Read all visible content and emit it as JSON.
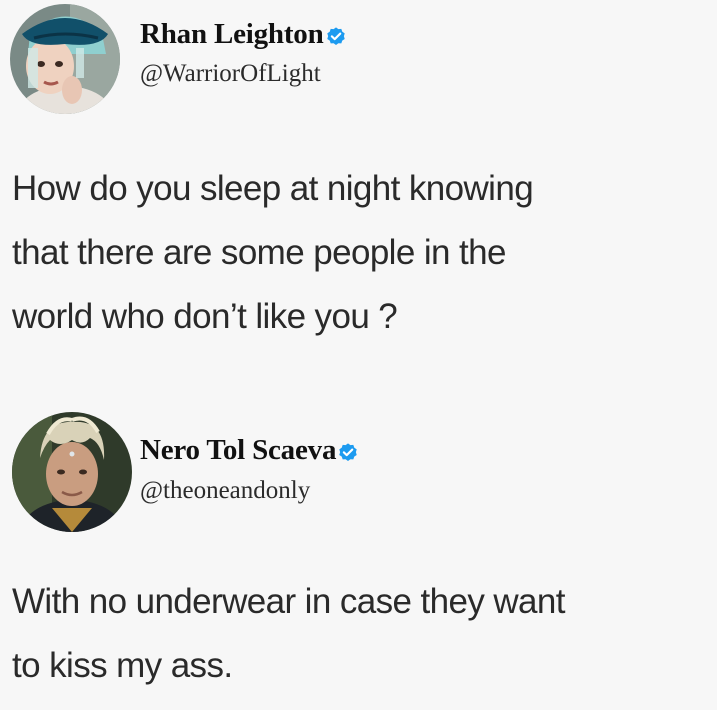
{
  "colors": {
    "background": "#f7f7f7",
    "verified_badge": "#1d9bf0",
    "text": "#2a2a2a"
  },
  "tweets": [
    {
      "display_name": "Rhan Leighton",
      "handle": "@WarriorOfLight",
      "verified": true,
      "avatar_icon": "avatar-woman-teal-hat",
      "text_lines": [
        "How do you sleep at night knowing",
        "that there are some people in the",
        "world who don’t like you ?"
      ]
    },
    {
      "display_name": "Nero Tol Scaeva",
      "handle": "@theoneandonly",
      "verified": true,
      "avatar_icon": "avatar-man-blond-hair",
      "text_lines": [
        "With no underwear in case they want",
        "to kiss my ass."
      ]
    }
  ]
}
